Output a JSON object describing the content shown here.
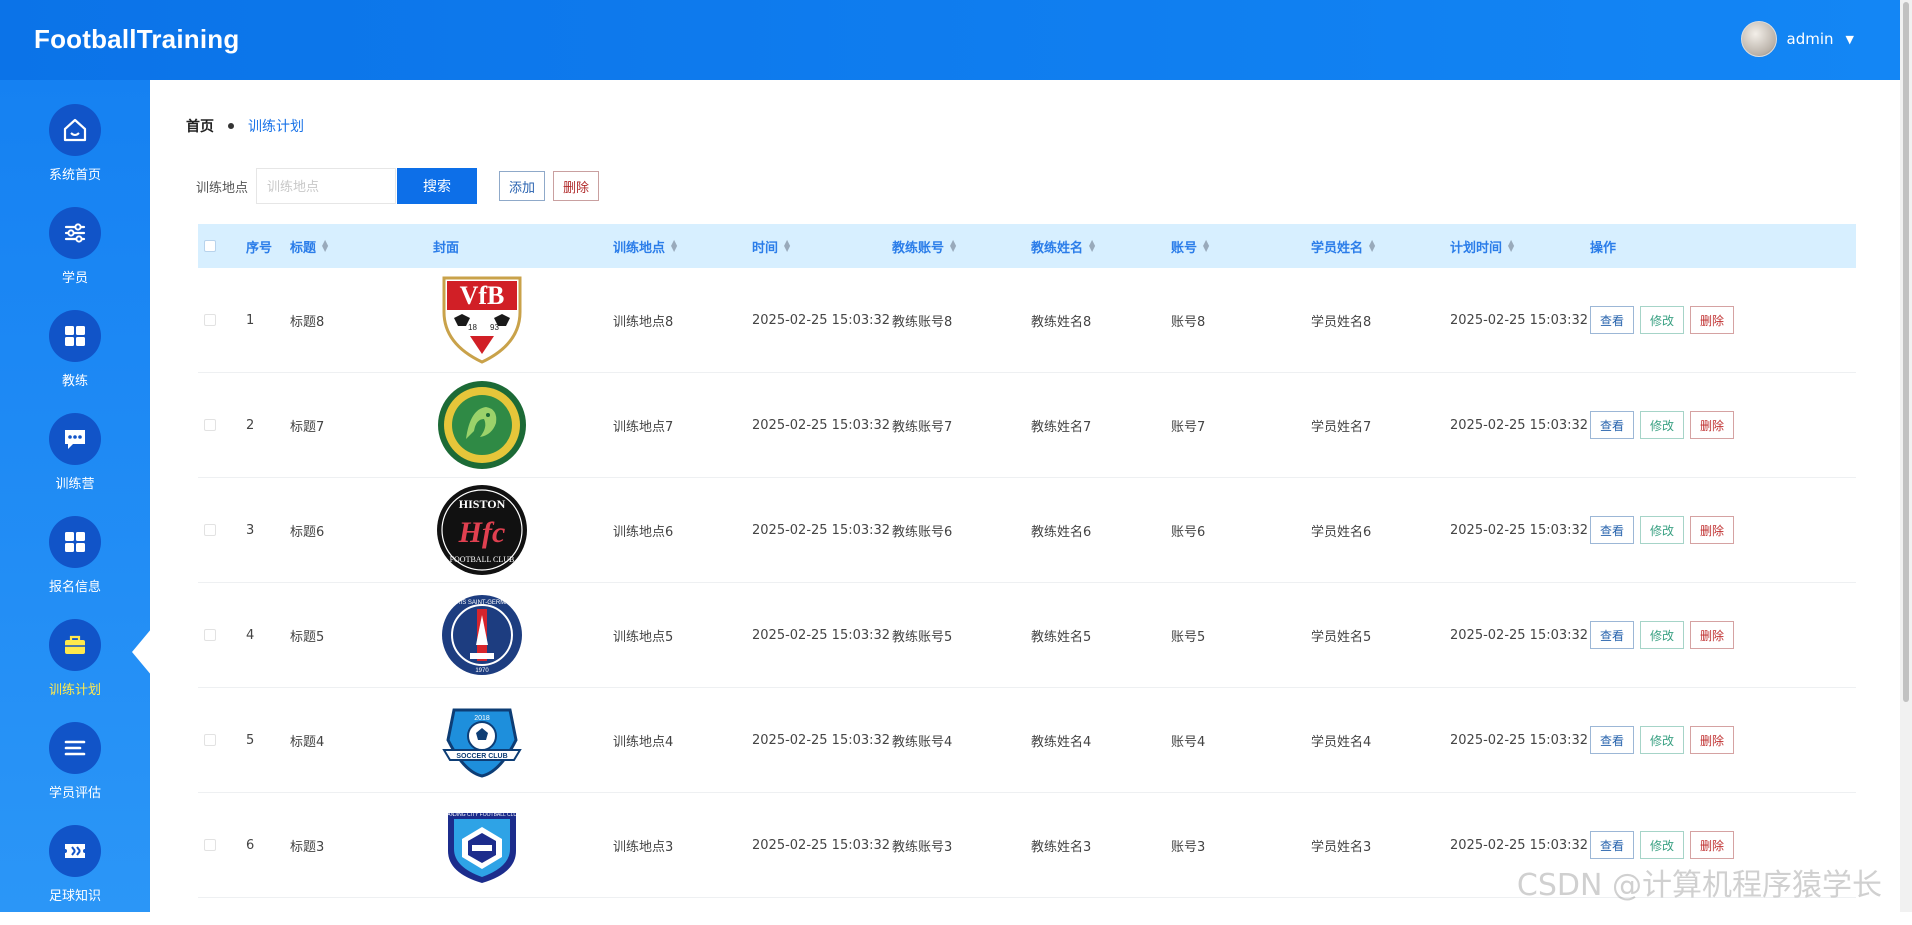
{
  "header": {
    "logo": "FootballTraining",
    "username": "admin"
  },
  "sidebar": {
    "items": [
      {
        "label": "系统首页",
        "icon": "home-icon",
        "active": false
      },
      {
        "label": "学员",
        "icon": "sliders-icon",
        "active": false
      },
      {
        "label": "教练",
        "icon": "grid-icon",
        "active": false
      },
      {
        "label": "训练营",
        "icon": "chat-icon",
        "active": false
      },
      {
        "label": "报名信息",
        "icon": "grid-icon",
        "active": false
      },
      {
        "label": "训练计划",
        "icon": "briefcase-icon",
        "active": true
      },
      {
        "label": "学员评估",
        "icon": "list-icon",
        "active": false
      },
      {
        "label": "足球知识",
        "icon": "ticket-icon",
        "active": false
      }
    ]
  },
  "breadcrumb": {
    "home": "首页",
    "current": "训练计划"
  },
  "search": {
    "label": "训练地点",
    "placeholder": "训练地点",
    "search_button": "搜索",
    "add_button": "添加",
    "delete_button": "删除"
  },
  "table": {
    "columns": [
      "序号",
      "标题",
      "封面",
      "训练地点",
      "时间",
      "教练账号",
      "教练姓名",
      "账号",
      "学员姓名",
      "计划时间",
      "操作"
    ],
    "actions": {
      "view": "查看",
      "edit": "修改",
      "delete": "删除"
    },
    "rows": [
      {
        "index": "1",
        "title": "标题8",
        "cover": "vfb-crest",
        "location": "训练地点8",
        "time": "2025-02-25 15:03:32",
        "coach_account": "教练账号8",
        "coach_name": "教练姓名8",
        "account": "账号8",
        "student": "学员姓名8",
        "plan_time": "2025-02-25 15:03:32"
      },
      {
        "index": "2",
        "title": "标题7",
        "cover": "green-dragon-crest",
        "location": "训练地点7",
        "time": "2025-02-25 15:03:32",
        "coach_account": "教练账号7",
        "coach_name": "教练姓名7",
        "account": "账号7",
        "student": "学员姓名7",
        "plan_time": "2025-02-25 15:03:32"
      },
      {
        "index": "3",
        "title": "标题6",
        "cover": "histon-crest",
        "location": "训练地点6",
        "time": "2025-02-25 15:03:32",
        "coach_account": "教练账号6",
        "coach_name": "教练姓名6",
        "account": "账号6",
        "student": "学员姓名6",
        "plan_time": "2025-02-25 15:03:32"
      },
      {
        "index": "4",
        "title": "标题5",
        "cover": "psg-crest",
        "location": "训练地点5",
        "time": "2025-02-25 15:03:32",
        "coach_account": "教练账号5",
        "coach_name": "教练姓名5",
        "account": "账号5",
        "student": "学员姓名5",
        "plan_time": "2025-02-25 15:03:32"
      },
      {
        "index": "5",
        "title": "标题4",
        "cover": "blue-soccer-club-crest",
        "location": "训练地点4",
        "time": "2025-02-25 15:03:32",
        "coach_account": "教练账号4",
        "coach_name": "教练姓名4",
        "account": "账号4",
        "student": "学员姓名4",
        "plan_time": "2025-02-25 15:03:32"
      },
      {
        "index": "6",
        "title": "标题3",
        "cover": "nanjing-city-crest",
        "location": "训练地点3",
        "time": "2025-02-25 15:03:32",
        "coach_account": "教练账号3",
        "coach_name": "教练姓名3",
        "account": "账号3",
        "student": "学员姓名3",
        "plan_time": "2025-02-25 15:03:32"
      }
    ]
  },
  "watermark": "CSDN @计算机程序猿学长"
}
